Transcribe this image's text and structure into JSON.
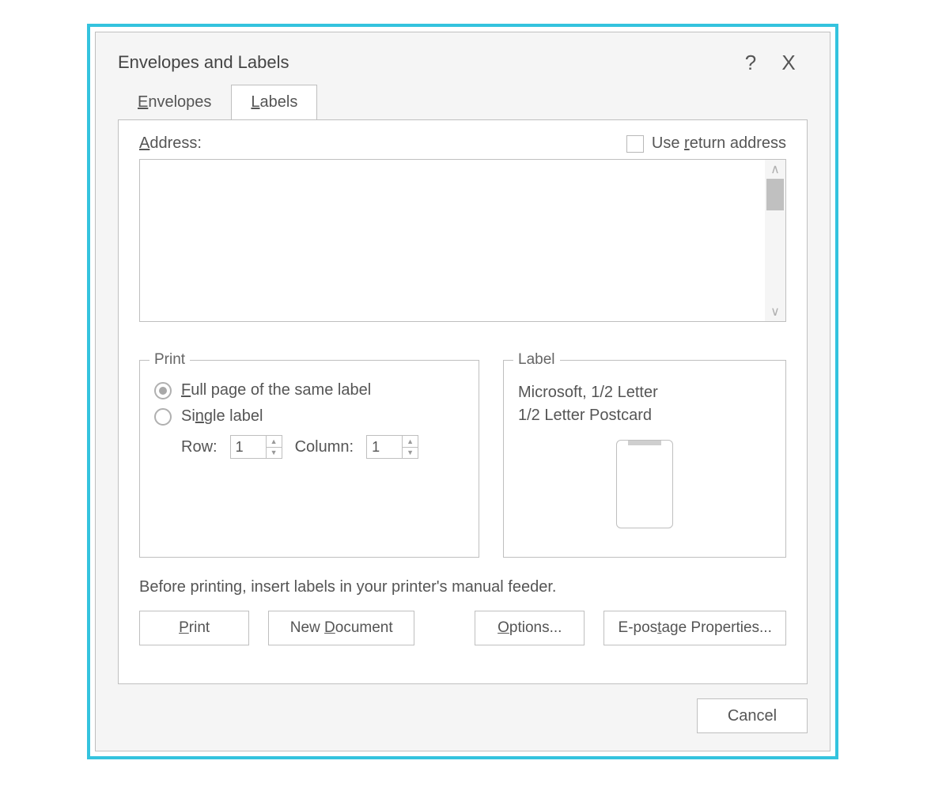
{
  "dialog": {
    "title": "Envelopes and Labels"
  },
  "tabs": {
    "envelopes": "Envelopes",
    "labels": "Labels"
  },
  "address": {
    "label": "Address:",
    "use_return": "Use return address"
  },
  "print_group": {
    "legend": "Print",
    "full_page": "Full page of the same label",
    "single": "Single label",
    "row_label": "Row:",
    "row_value": "1",
    "column_label": "Column:",
    "column_value": "1"
  },
  "label_group": {
    "legend": "Label",
    "line1": "Microsoft, 1/2 Letter",
    "line2": "1/2 Letter Postcard"
  },
  "hint": "Before printing, insert labels in your printer's manual feeder.",
  "buttons": {
    "print": "Print",
    "new_document": "New Document",
    "options": "Options...",
    "epostage": "E-postage Properties...",
    "cancel": "Cancel"
  }
}
